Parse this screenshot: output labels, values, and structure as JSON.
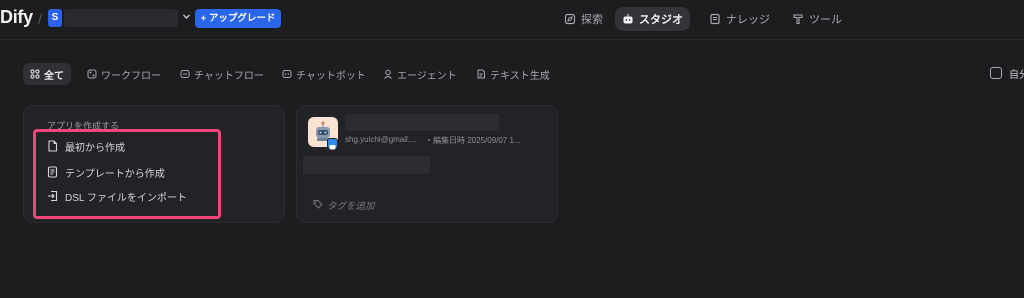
{
  "header": {
    "logo": "Dify",
    "workspace": {
      "initial": "S"
    },
    "upgrade_label": "+ アップグレード",
    "nav": [
      {
        "label": "探索",
        "icon": "compass-icon"
      },
      {
        "label": "スタジオ",
        "icon": "robot-icon",
        "active": true
      },
      {
        "label": "ナレッジ",
        "icon": "book-icon"
      },
      {
        "label": "ツール",
        "icon": "hammer-icon"
      }
    ]
  },
  "filters": {
    "tabs": [
      {
        "label": "全て",
        "icon": "grid-icon",
        "active": true
      },
      {
        "label": "ワークフロー",
        "icon": "workflow-icon"
      },
      {
        "label": "チャットフロー",
        "icon": "chatflow-icon"
      },
      {
        "label": "チャットボット",
        "icon": "chatbot-icon"
      },
      {
        "label": "エージェント",
        "icon": "agent-icon"
      },
      {
        "label": "テキスト生成",
        "icon": "text-gen-icon"
      }
    ],
    "mine_label": "自分"
  },
  "create_card": {
    "title": "アプリを作成する",
    "options": [
      {
        "label": "最初から作成",
        "icon": "blank-file-icon"
      },
      {
        "label": "テンプレートから作成",
        "icon": "template-icon"
      },
      {
        "label": "DSL ファイルをインポート",
        "icon": "import-icon"
      }
    ]
  },
  "app_card": {
    "author": "shg.yuichi@gmail....",
    "meta": "・編集日時 2025/09/07 1...",
    "tag_placeholder": "タグを追加"
  },
  "colors": {
    "background": "#1d1d20",
    "card": "#232327",
    "accent_blue": "#2a66e9",
    "highlight": "#f2457b"
  }
}
